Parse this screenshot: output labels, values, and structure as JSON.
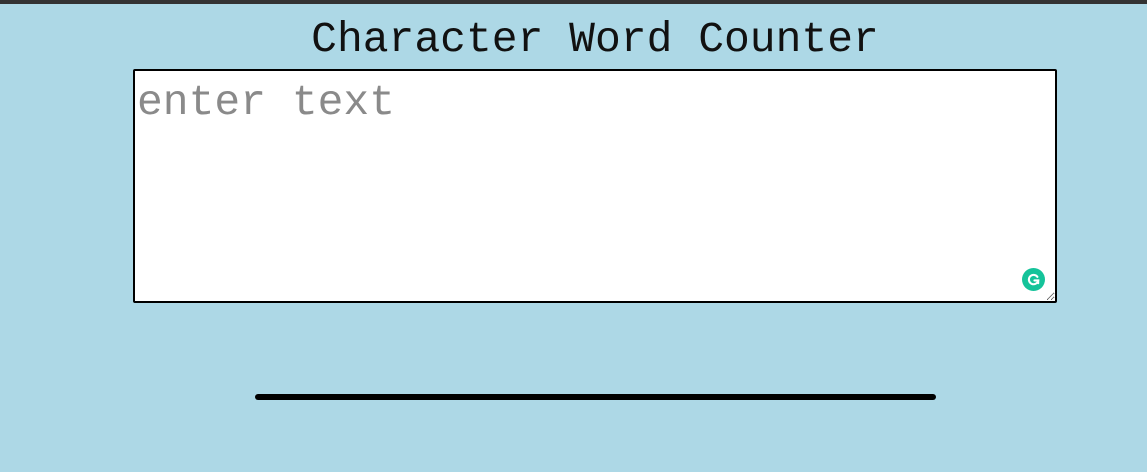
{
  "header": {
    "title": "Character Word Counter"
  },
  "editor": {
    "value": "",
    "placeholder": "enter text"
  },
  "icons": {
    "grammar_assistant": "grammarly-g-icon"
  },
  "colors": {
    "background": "#add8e6",
    "top_bar": "#333333",
    "grammar_icon": "#15c39a",
    "divider": "#000000"
  }
}
